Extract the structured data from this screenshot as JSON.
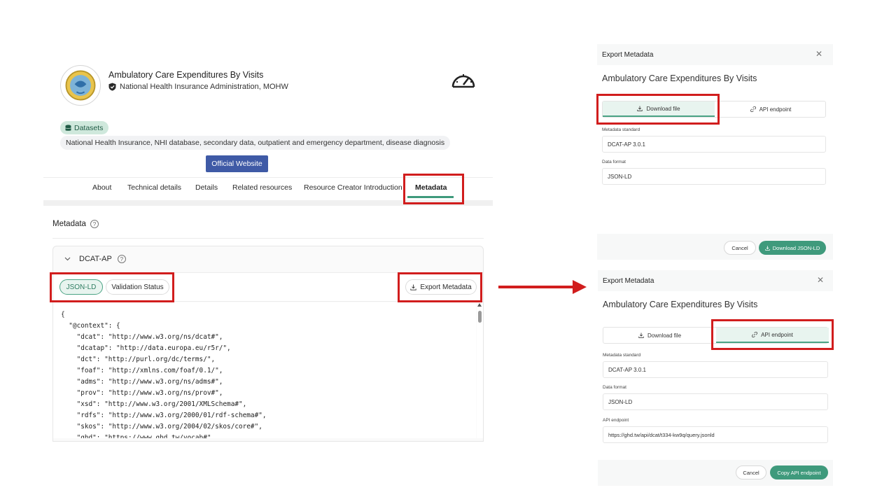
{
  "dataset": {
    "title": "Ambulatory Care Expenditures By Visits",
    "org": "National Health Insurance Administration, MOHW",
    "category": "Datasets",
    "keywords": "National Health Insurance, NHI database, secondary data, outpatient and emergency department, disease diagnosis",
    "official_website": "Official Website"
  },
  "tabs": [
    "About",
    "Technical details",
    "Details",
    "Related resources",
    "Resource Creator Introduction",
    "Metadata"
  ],
  "active_tab": "Metadata",
  "metadata_section": {
    "heading": "Metadata",
    "standard": "DCAT-AP",
    "view_tabs": [
      "JSON-LD",
      "Validation Status"
    ],
    "export_label": "Export Metadata"
  },
  "code_lines": [
    "{",
    "  \"@context\": {",
    "    \"dcat\": \"http://www.w3.org/ns/dcat#\",",
    "    \"dcatap\": \"http://data.europa.eu/r5r/\",",
    "    \"dct\": \"http://purl.org/dc/terms/\",",
    "    \"foaf\": \"http://xmlns.com/foaf/0.1/\",",
    "    \"adms\": \"http://www.w3.org/ns/adms#\",",
    "    \"prov\": \"http://www.w3.org/ns/prov#\",",
    "    \"xsd\": \"http://www.w3.org/2001/XMLSchema#\",",
    "    \"rdfs\": \"http://www.w3.org/2000/01/rdf-schema#\",",
    "    \"skos\": \"http://www.w3.org/2004/02/skos/core#\",",
    "    \"ghd\": \"https://www.ghd.tw/vocab#\""
  ],
  "dialog_download": {
    "header": "Export Metadata",
    "title": "Ambulatory Care Expenditures By Visits",
    "tab_download": "Download file",
    "tab_api": "API endpoint",
    "standard_label": "Metadata standard",
    "standard_value": "DCAT-AP 3.0.1",
    "format_label": "Data format",
    "format_value": "JSON-LD",
    "cancel": "Cancel",
    "primary": "Download JSON-LD"
  },
  "dialog_api": {
    "header": "Export Metadata",
    "title": "Ambulatory Care Expenditures By Visits",
    "tab_download": "Download file",
    "tab_api": "API endpoint",
    "standard_label": "Metadata standard",
    "standard_value": "DCAT-AP 3.0.1",
    "format_label": "Data format",
    "format_value": "JSON-LD",
    "endpoint_label": "API endpoint",
    "endpoint_value": "https://ghd.tw/api/dcat/t334-kw9q/query.jsonld",
    "cancel": "Cancel",
    "primary": "Copy API endpoint"
  },
  "colors": {
    "accent_green": "#3f9a7c",
    "highlight_red": "#d11d1d",
    "official_btn": "#3f5aa6"
  }
}
